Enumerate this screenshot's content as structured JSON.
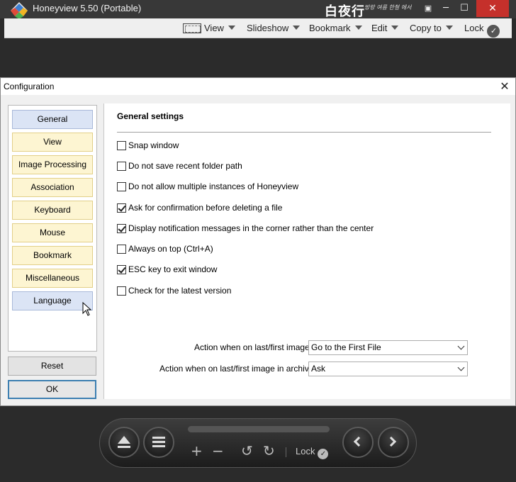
{
  "app": {
    "title": "Honeyview 5.50 (Portable)",
    "brand": "白夜行",
    "brand_slogan": "방랑 여름 한철 에서"
  },
  "window_buttons": {
    "pin": "▣",
    "minimize": "─",
    "maximize": "☐",
    "close": "✕"
  },
  "menubar": {
    "view": "View",
    "slideshow": "Slideshow",
    "bookmark": "Bookmark",
    "edit": "Edit",
    "copy_to": "Copy to",
    "lock": "Lock"
  },
  "dialog": {
    "title": "Configuration",
    "close": "✕",
    "nav": [
      "General",
      "View",
      "Image Processing",
      "Association",
      "Keyboard",
      "Mouse",
      "Bookmark",
      "Miscellaneous",
      "Language"
    ],
    "active_nav": "General",
    "reset_label": "Reset",
    "ok_label": "OK",
    "settings": {
      "heading": "General settings",
      "options": [
        {
          "label": "Snap window",
          "checked": false
        },
        {
          "label": "Do not save recent folder path",
          "checked": false
        },
        {
          "label": "Do not allow multiple instances of Honeyview",
          "checked": false
        },
        {
          "label": "Ask for confirmation before deleting a file",
          "checked": true
        },
        {
          "label": "Display notification messages in the corner rather than the center",
          "checked": true
        },
        {
          "label": "Always on top (Ctrl+A)",
          "checked": false
        },
        {
          "label": "ESC key to exit window",
          "checked": true
        },
        {
          "label": "Check for the latest version",
          "checked": false
        }
      ],
      "action_last_first_label": "Action when on last/first image:",
      "action_last_first_value": "Go to the First File",
      "action_archive_label": "Action when on last/first image in archive:",
      "action_archive_value": "Ask"
    }
  },
  "controlbar": {
    "zoom_in": "+",
    "zoom_out": "−",
    "rotate_left": "↺",
    "rotate_right": "↻",
    "lock_label": "Lock",
    "lock_check": "✓"
  }
}
